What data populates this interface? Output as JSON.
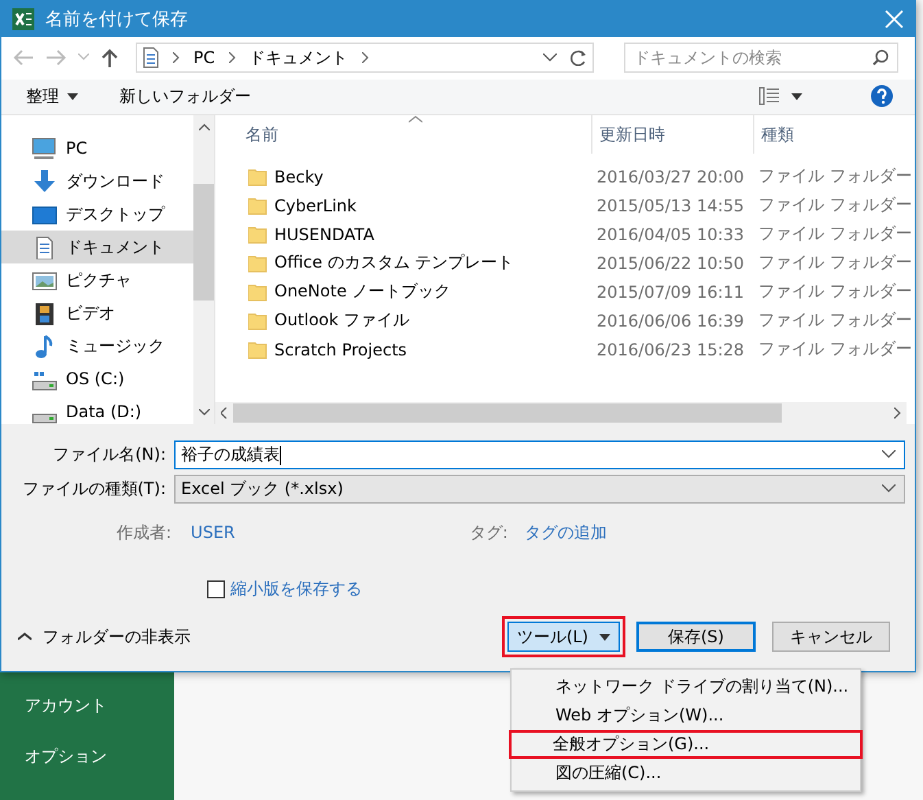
{
  "window": {
    "title": "名前を付けて保存"
  },
  "address_bar": {
    "path": [
      "PC",
      "ドキュメント"
    ]
  },
  "search": {
    "placeholder": "ドキュメントの検索"
  },
  "toolbar": {
    "organize": "整理",
    "new_folder": "新しいフォルダー"
  },
  "sidebar": {
    "items": [
      {
        "label": "PC",
        "kind": "pc",
        "selected": false
      },
      {
        "label": "ダウンロード",
        "kind": "download",
        "selected": false
      },
      {
        "label": "デスクトップ",
        "kind": "desktop",
        "selected": false
      },
      {
        "label": "ドキュメント",
        "kind": "document",
        "selected": true
      },
      {
        "label": "ピクチャ",
        "kind": "picture",
        "selected": false
      },
      {
        "label": "ビデオ",
        "kind": "video",
        "selected": false
      },
      {
        "label": "ミュージック",
        "kind": "music",
        "selected": false
      },
      {
        "label": "OS (C:)",
        "kind": "system-drive",
        "selected": false
      },
      {
        "label": "Data (D:)",
        "kind": "drive",
        "selected": false
      }
    ]
  },
  "file_list": {
    "columns": [
      "名前",
      "更新日時",
      "種類"
    ],
    "rows": [
      {
        "name": "Becky",
        "modified": "2016/03/27 20:00",
        "type": "ファイル フォルダー"
      },
      {
        "name": "CyberLink",
        "modified": "2015/05/13 14:55",
        "type": "ファイル フォルダー"
      },
      {
        "name": "HUSENDATA",
        "modified": "2016/04/05 10:33",
        "type": "ファイル フォルダー"
      },
      {
        "name": "Office のカスタム テンプレート",
        "modified": "2015/06/22 10:50",
        "type": "ファイル フォルダー"
      },
      {
        "name": "OneNote ノートブック",
        "modified": "2015/07/09 16:11",
        "type": "ファイル フォルダー"
      },
      {
        "name": "Outlook ファイル",
        "modified": "2016/06/06 16:39",
        "type": "ファイル フォルダー"
      },
      {
        "name": "Scratch Projects",
        "modified": "2016/06/23 15:28",
        "type": "ファイル フォルダー"
      }
    ]
  },
  "form": {
    "file_name_label": "ファイル名(N):",
    "file_name": "裕子の成績表",
    "file_type_label": "ファイルの種類(T):",
    "file_type": "Excel ブック (*.xlsx)",
    "author_label": "作成者:",
    "author": "USER",
    "tags_label": "タグ:",
    "tags": "タグの追加",
    "thumbnail": {
      "label": "縮小版を保存する",
      "checked": false
    }
  },
  "footer": {
    "hide_folders": "フォルダーの非表示",
    "buttons": [
      {
        "label": "ツール(L)",
        "kind": "dropdown",
        "highlighted": true
      },
      {
        "label": "保存(S)",
        "kind": "default",
        "highlighted": false
      },
      {
        "label": "キャンセル",
        "kind": "plain",
        "highlighted": false
      }
    ]
  },
  "tools_menu": {
    "items": [
      {
        "label": "ネットワーク ドライブの割り当て(N)...",
        "highlighted": false
      },
      {
        "label": "Web オプション(W)...",
        "highlighted": false
      },
      {
        "label": "全般オプション(G)...",
        "highlighted": true
      },
      {
        "label": "図の圧縮(C)...",
        "highlighted": false
      }
    ]
  },
  "backstage": {
    "items": [
      "アカウント",
      "オプション"
    ]
  }
}
